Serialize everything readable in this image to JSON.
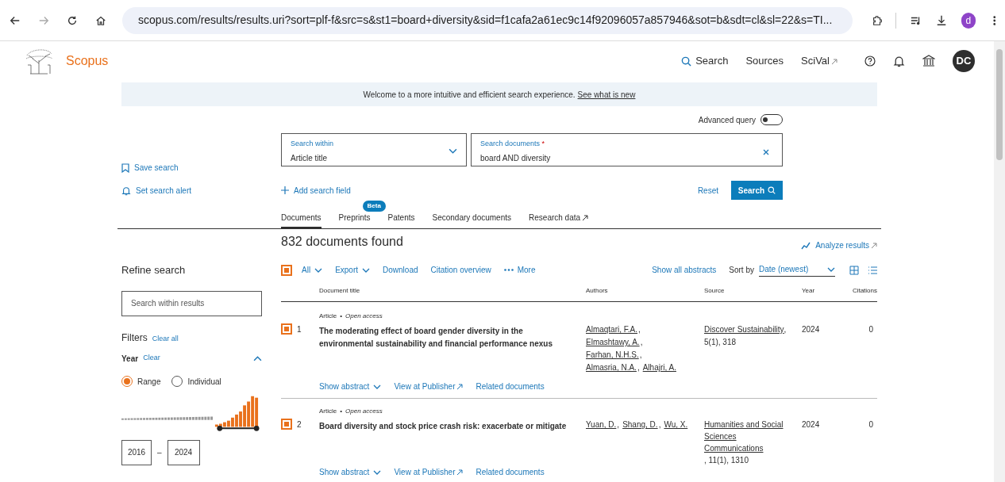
{
  "browser": {
    "url": "scopus.com/results/results.uri?sort=plf-f&src=s&st1=board+diversity&sid=f1cafa2a61ec9c14f92096057a857946&sot=b&sdt=cl&sl=22&s=TI...",
    "profile": "d"
  },
  "header": {
    "brand": "Scopus",
    "nav": [
      {
        "label": "Search",
        "kind": "search"
      },
      {
        "label": "Sources",
        "kind": "plain"
      },
      {
        "label": "SciVal",
        "kind": "external"
      }
    ],
    "avatar": "DC"
  },
  "banner": {
    "text": "Welcome to a more intuitive and efficient search experience.",
    "link": "See what is new"
  },
  "side_actions": [
    {
      "label": "Save search",
      "kind": "bookmark"
    },
    {
      "label": "Set search alert",
      "kind": "bell"
    }
  ],
  "advanced_query": {
    "label": "Advanced query",
    "on": false
  },
  "search_within": {
    "label": "Search within",
    "value": "Article title"
  },
  "search_documents": {
    "label": "Search documents",
    "required_mark": "*",
    "value": "board AND diversity"
  },
  "add_field": "Add search field",
  "reset": "Reset",
  "search_button": "Search",
  "tabs": [
    {
      "label": "Documents",
      "selected": true
    },
    {
      "label": "Preprints",
      "selected": false,
      "badge": "Beta"
    },
    {
      "label": "Patents",
      "selected": false
    },
    {
      "label": "Secondary documents",
      "selected": false
    },
    {
      "label": "Research data",
      "selected": false,
      "external": true
    }
  ],
  "refine": {
    "title": "Refine search",
    "placeholder": "Search within results",
    "filters": "Filters",
    "clear_all": "Clear all",
    "year_label": "Year",
    "year_clear": "Clear",
    "modes": [
      {
        "label": "Range",
        "selected": true
      },
      {
        "label": "Individual",
        "selected": false
      }
    ],
    "from": "2016",
    "dash": "–",
    "to": "2024"
  },
  "results": {
    "count": "832 documents found",
    "analyze": "Analyze results",
    "select_all": true,
    "toolbar": [
      "All",
      "Export",
      "Download",
      "Citation overview",
      "More"
    ],
    "show_all": "Show all abstracts",
    "sort_label": "Sort by",
    "sort_value": "Date (newest)"
  },
  "table": {
    "columns": [
      "Document title",
      "Authors",
      "Source",
      "Year",
      "Citations"
    ],
    "rows": [
      {
        "selected": true,
        "number": "1",
        "type": "Article",
        "separator": "•",
        "access": "Open access",
        "title": "The moderating effect of board gender diversity in the environmental sustainability and financial performance nexus",
        "authors": [
          "Almaqtari, F.A.",
          "Elmashtawy, A.",
          "Farhan, N.H.S.",
          "Almasria, N.A.",
          "Alhajri, A."
        ],
        "author_separator": ",",
        "source": "Discover Sustainability",
        "source_separator": ",",
        "source_detail": "5(1), 318",
        "year": "2024",
        "citations": "0",
        "actions": [
          "Show abstract",
          "View at Publisher",
          "Related documents"
        ]
      },
      {
        "selected": true,
        "number": "2",
        "type": "Article",
        "separator": "•",
        "access": "Open access",
        "title": "Board diversity and stock price crash risk: exacerbate or mitigate",
        "authors": [
          "Yuan, D.",
          "Shang, D.",
          "Wu, X."
        ],
        "author_separator": ",",
        "source": "Humanities and Social Sciences Communications",
        "source_detail": ", 11(1), 1310",
        "year": "2024",
        "citations": "0",
        "actions": [
          "Show abstract",
          "View at Publisher",
          "Related documents"
        ]
      }
    ]
  }
}
